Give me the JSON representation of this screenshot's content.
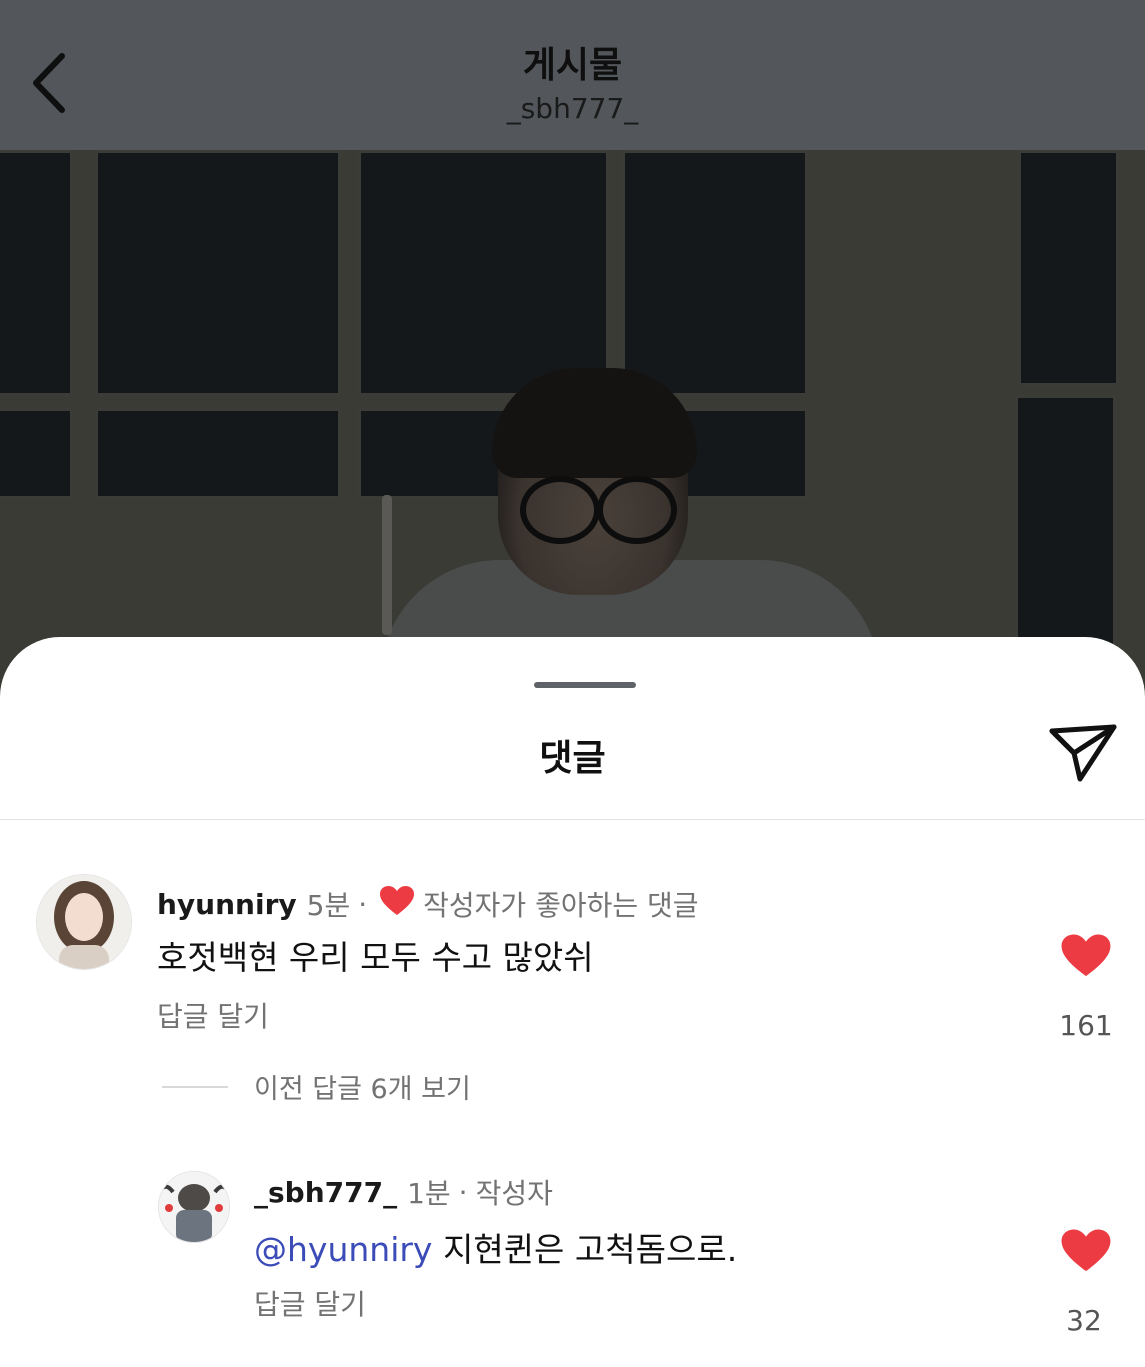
{
  "header": {
    "title": "게시물",
    "subtitle": "_sbh777_",
    "back_icon": "chevron-left-icon"
  },
  "sheet": {
    "title": "댓글",
    "share_icon": "send-icon"
  },
  "comments": [
    {
      "username": "hyunniry",
      "time": "5분",
      "separator": "·",
      "badge": "작성자가 좋아하는 댓글",
      "text": "호젓백현 우리 모두 수고 많았쉬",
      "reply_label": "답글 달기",
      "likes": "161",
      "liked": true,
      "heart_color": "#ed3b44"
    }
  ],
  "view_replies": "이전 답글 6개 보기",
  "replies": [
    {
      "username": "_sbh777_",
      "time": "1분",
      "separator": "·",
      "badge": "작성자",
      "mention": "@hyunniry",
      "text": "지현퀸은 고척돔으로.",
      "reply_label": "답글 달기",
      "likes": "32",
      "liked": true
    }
  ],
  "colors": {
    "header_bg": "#53575b",
    "like_red": "#ed3b44",
    "mention_blue": "#3b4bb8"
  }
}
